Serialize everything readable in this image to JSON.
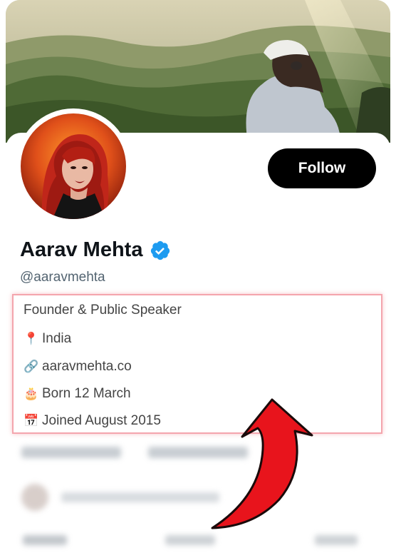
{
  "profile": {
    "follow_label": "Follow",
    "name": "Aarav Mehta",
    "handle": "@aaravmehta",
    "verified": true,
    "accent_color": "#1d9bf0"
  },
  "bio": {
    "description": "Founder & Public Speaker",
    "location_icon": "📍",
    "location": "India",
    "website_icon": "🔗",
    "website": "aaravmehta.co",
    "birthday_icon": "🎂",
    "birthday": "Born 12 March",
    "joined_icon": "📅",
    "joined": "Joined August 2015"
  },
  "colors": {
    "highlight_border": "#f4a5ad",
    "annotation_arrow": "#e8141c"
  }
}
